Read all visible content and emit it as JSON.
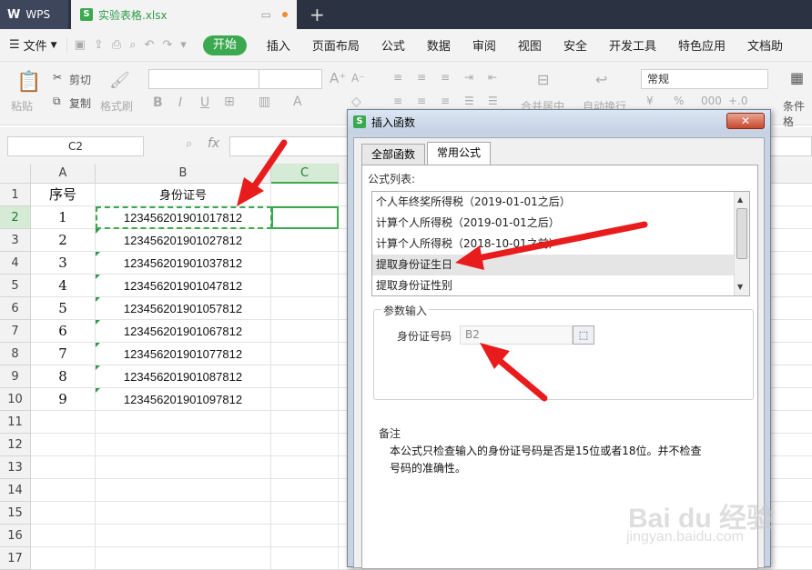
{
  "titlebar": {
    "app_label": "WPS",
    "doc_tab": "实验表格.xlsx",
    "new_tab": "+"
  },
  "menubar": {
    "file": "文件",
    "tabs": [
      "开始",
      "插入",
      "页面布局",
      "公式",
      "数据",
      "审阅",
      "视图",
      "安全",
      "开发工具",
      "特色应用",
      "文档助"
    ]
  },
  "ribbon": {
    "paste": "粘贴",
    "cut": "剪切",
    "copy": "复制",
    "format_painter": "格式刷",
    "number_format": "常规",
    "merge": "合并居中",
    "wrap": "自动换行",
    "cond_format": "条件格"
  },
  "formula_bar": {
    "name_box": "C2",
    "fx": "fx",
    "value": ""
  },
  "sheet": {
    "columns": [
      "A",
      "B",
      "C"
    ],
    "header_row": {
      "a": "序号",
      "b": "身份证号"
    },
    "rows": [
      {
        "n": "1",
        "id": "123456201901017812"
      },
      {
        "n": "2",
        "id": "123456201901027812"
      },
      {
        "n": "3",
        "id": "123456201901037812"
      },
      {
        "n": "4",
        "id": "123456201901047812"
      },
      {
        "n": "5",
        "id": "123456201901057812"
      },
      {
        "n": "6",
        "id": "123456201901067812"
      },
      {
        "n": "7",
        "id": "123456201901077812"
      },
      {
        "n": "8",
        "id": "123456201901087812"
      },
      {
        "n": "9",
        "id": "123456201901097812"
      }
    ],
    "row_numbers": [
      "1",
      "2",
      "3",
      "4",
      "5",
      "6",
      "7",
      "8",
      "9",
      "10",
      "11",
      "12",
      "13",
      "14",
      "15",
      "16",
      "17"
    ]
  },
  "dialog": {
    "title": "插入函数",
    "tabs": [
      "全部函数",
      "常用公式"
    ],
    "list_label": "公式列表:",
    "formulas": [
      "个人年终奖所得税（2019-01-01之后）",
      "计算个人所得税（2019-01-01之后）",
      "计算个人所得税（2018-10-01之前）",
      "提取身份证生日",
      "提取身份证性别"
    ],
    "selected_index": 3,
    "params_legend": "参数输入",
    "param_label": "身份证号码",
    "param_value": "B2",
    "note_title": "备注",
    "note_text": "本公式只检查输入的身份证号码是否是15位或者18位。并不检查号码的准确性。"
  },
  "watermark": {
    "brand": "Bai du 经验",
    "url": "jingyan.baidu.com"
  },
  "colors": {
    "accent": "#3ba94f",
    "arrow": "#e81c1c",
    "titlebar": "#2b3343"
  }
}
